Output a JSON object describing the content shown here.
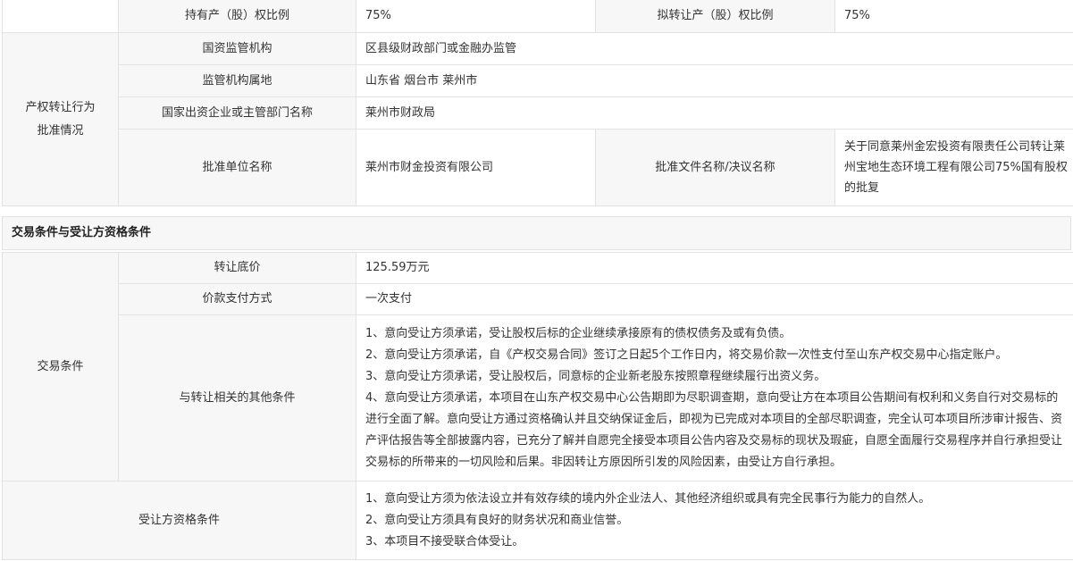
{
  "rights_section": {
    "holding_ratio_label": "持有产（股）权比例",
    "holding_ratio_value": "75%",
    "transfer_ratio_label": "拟转让产（股）权比例",
    "transfer_ratio_value": "75%",
    "group_label_line1": "产权转让行为",
    "group_label_line2": "批准情况",
    "supervisor_label": "国资监管机构",
    "supervisor_value": "区县级财政部门或金融办监管",
    "location_label": "监管机构属地",
    "location_value": "山东省 烟台市 莱州市",
    "competent_dept_label": "国家出资企业或主管部门名称",
    "competent_dept_value": "莱州市财政局",
    "approver_label": "批准单位名称",
    "approver_value": "莱州市财金投资有限公司",
    "approval_doc_label": "批准文件名称/决议名称",
    "approval_doc_value": "关于同意莱州金宏投资有限责任公司转让莱州宝地生态环境工程有限公司75%国有股权的批复"
  },
  "section_heading": "交易条件与受让方资格条件",
  "conditions": {
    "group_label": "交易条件",
    "base_price_label": "转让底价",
    "base_price_value": "125.59万元",
    "payment_label": "价款支付方式",
    "payment_value": "一次支付",
    "other_label": "与转让相关的其他条件",
    "other_lines": [
      "1、意向受让方须承诺，受让股权后标的企业继续承接原有的债权债务及或有负债。",
      "2、意向受让方须承诺，自《产权交易合同》签订之日起5个工作日内，将交易价款一次性支付至山东产权交易中心指定账户。",
      "3、意向受让方须承诺，受让股权后，同意标的企业新老股东按照章程继续履行出资义务。",
      "4、意向受让方须承诺，本项目在山东产权交易中心公告期即为尽职调查期，意向受让方在本项目公告期间有权利和义务自行对交易标的进行全面了解。意向受让方通过资格确认并且交纳保证金后，即视为已完成对本项目的全部尽职调查，完全认可本项目所涉审计报告、资产评估报告等全部披露内容，已充分了解并自愿完全接受本项目公告内容及交易标的现状及瑕疵，自愿全面履行交易程序并自行承担受让交易标的所带来的一切风险和后果。非因转让方原因所引发的风险因素，由受让方自行承担。"
    ]
  },
  "qualification": {
    "label": "受让方资格条件",
    "lines": [
      "1、意向受让方须为依法设立并有效存续的境内外企业法人、其他经济组织或具有完全民事行为能力的自然人。",
      "2、意向受让方须具有良好的财务状况和商业信誉。",
      "3、本项目不接受联合体受让。"
    ]
  }
}
